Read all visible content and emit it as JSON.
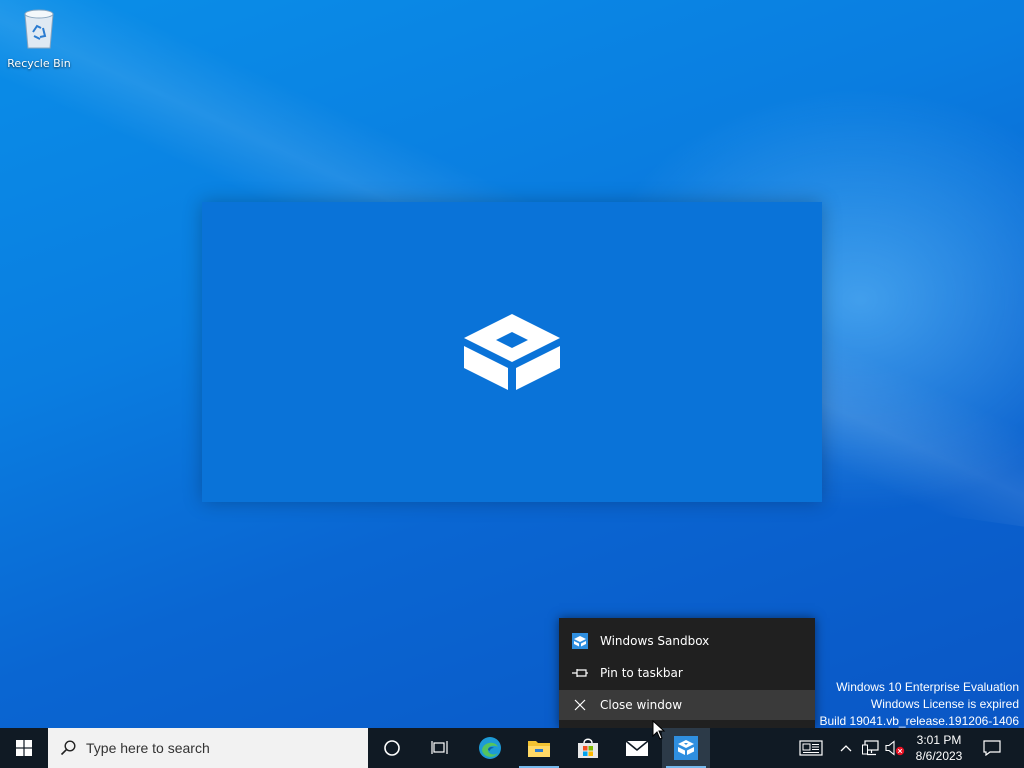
{
  "desktop": {
    "icons": [
      {
        "label": "Recycle Bin",
        "icon": "recycle-bin-icon"
      }
    ]
  },
  "sandbox_window": {
    "icon": "windows-sandbox-logo",
    "background": "#0a73d8"
  },
  "jump_list": {
    "items": [
      {
        "label": "Windows Sandbox",
        "icon": "windows-sandbox-icon"
      },
      {
        "label": "Pin to taskbar",
        "icon": "pin-icon"
      },
      {
        "label": "Close window",
        "icon": "close-icon",
        "hovered": true
      }
    ]
  },
  "watermark": {
    "line1": "Windows 10 Enterprise Evaluation",
    "line2": "Windows License is expired",
    "line3": "Build 19041.vb_release.191206-1406"
  },
  "taskbar": {
    "search_placeholder": "Type here to search",
    "apps": [
      {
        "name": "Cortana",
        "icon": "cortana-icon"
      },
      {
        "name": "Task View",
        "icon": "task-view-icon"
      },
      {
        "name": "Microsoft Edge",
        "icon": "edge-icon"
      },
      {
        "name": "File Explorer",
        "icon": "file-explorer-icon"
      },
      {
        "name": "Microsoft Store",
        "icon": "store-icon"
      },
      {
        "name": "Mail",
        "icon": "mail-icon"
      },
      {
        "name": "Windows Sandbox",
        "icon": "windows-sandbox-icon",
        "active": true
      }
    ],
    "tray": {
      "time": "3:01 PM",
      "date": "8/6/2023",
      "icons": [
        "news-icon",
        "chevron-up-icon",
        "network-icon",
        "volume-muted-icon",
        "notification-icon"
      ]
    }
  },
  "colors": {
    "taskbar": "#101a24",
    "accent": "#76b9ed",
    "menu": "#202020",
    "menu_hover": "#3a3a3a"
  }
}
